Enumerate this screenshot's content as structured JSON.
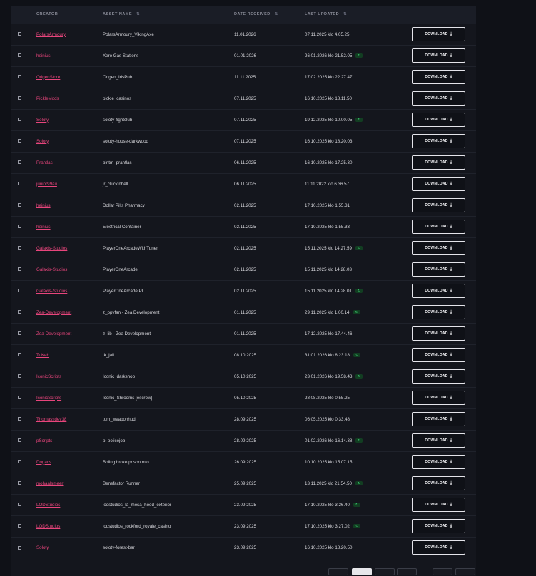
{
  "table": {
    "headers": {
      "creator": "CREATOR",
      "asset_name": "ASSET NAME",
      "date_received": "DATE RECEIVED",
      "last_updated": "LAST UPDATED",
      "sort_glyph": "⇅"
    },
    "download_label": "DOWNLOAD",
    "download_icon": "download-icon",
    "update_badge_icon": "refresh-icon",
    "accent_color": "#e8457c",
    "badge_color": "#3fd474",
    "rows": [
      {
        "creator": "PolarsArmoury",
        "asset": "PolarsArmoury_VikingAxe",
        "received": "11.01.2026",
        "updated": "07.11.2025 klo 4.05.25",
        "badge": false
      },
      {
        "creator": "heinius",
        "asset": "Xero Gas Stations",
        "received": "01.01.2026",
        "updated": "26.01.2026 klo 21.52.05",
        "badge": true
      },
      {
        "creator": "OrigenStore",
        "asset": "Origen_IrlsPub",
        "received": "11.11.2025",
        "updated": "17.02.2025 klo 22.27.47",
        "badge": false
      },
      {
        "creator": "PickleMods",
        "asset": "pickle_casinos",
        "received": "07.11.2025",
        "updated": "16.10.2025 klo 18.11.50",
        "badge": false
      },
      {
        "creator": "Soloty",
        "asset": "soloty-fightclub",
        "received": "07.11.2025",
        "updated": "19.12.2025 klo 10.00.05",
        "badge": true
      },
      {
        "creator": "Soloty",
        "asset": "soloty-house-darkwood",
        "received": "07.11.2025",
        "updated": "16.10.2025 klo 18.20.03",
        "badge": false
      },
      {
        "creator": "Prantlas",
        "asset": "bintm_prantlas",
        "received": "06.11.2025",
        "updated": "16.10.2025 klo 17.25.30",
        "badge": false
      },
      {
        "creator": "junior99au",
        "asset": "jr_cluckinbell",
        "received": "06.11.2025",
        "updated": "11.11.2022 klo 6.36.57",
        "badge": false
      },
      {
        "creator": "heinius",
        "asset": "Dollar Pills Pharmacy",
        "received": "02.11.2025",
        "updated": "17.10.2025 klo 1.55.31",
        "badge": false
      },
      {
        "creator": "heinius",
        "asset": "Electrical Container",
        "received": "02.11.2025",
        "updated": "17.10.2025 klo 1.55.33",
        "badge": false
      },
      {
        "creator": "Galaxis-Studios",
        "asset": "PlayerOneArcadeWithTuner",
        "received": "02.11.2025",
        "updated": "15.11.2025 klo 14.27.59",
        "badge": true
      },
      {
        "creator": "Galaxis-Studios",
        "asset": "PlayerOneArcade",
        "received": "02.11.2025",
        "updated": "15.11.2025 klo 14.28.03",
        "badge": false
      },
      {
        "creator": "Galaxis-Studios",
        "asset": "PlayerOneArcadeIPL",
        "received": "02.11.2025",
        "updated": "15.11.2025 klo 14.28.01",
        "badge": true
      },
      {
        "creator": "Zea-Development",
        "asset": "z_ppvfan - Zea Development",
        "received": "01.11.2025",
        "updated": "29.11.2025 klo 1.00.14",
        "badge": true
      },
      {
        "creator": "Zea-Development",
        "asset": "z_lib - Zea Development",
        "received": "01.11.2025",
        "updated": "17.12.2025 klo 17.44.46",
        "badge": false
      },
      {
        "creator": "TuKeh",
        "asset": "tk_jail",
        "received": "08.10.2025",
        "updated": "31.01.2026 klo 8.23.18",
        "badge": true
      },
      {
        "creator": "IconicScripts",
        "asset": "Iconic_darkshop",
        "received": "05.10.2025",
        "updated": "23.01.2026 klo 19.58.43",
        "badge": true
      },
      {
        "creator": "IconicScripts",
        "asset": "Iconic_Shrooms [escrow]",
        "received": "05.10.2025",
        "updated": "28.08.2025 klo 0.55.25",
        "badge": false
      },
      {
        "creator": "Thomassdev18",
        "asset": "tom_weaponhud",
        "received": "28.09.2025",
        "updated": "06.05.2025 klo 0.33.48",
        "badge": false
      },
      {
        "creator": "pScripts",
        "asset": "p_policejob",
        "received": "28.09.2025",
        "updated": "01.02.2026 klo 16.14.38",
        "badge": true
      },
      {
        "creator": "Dogacs",
        "asset": "Boling broke prison mlo",
        "received": "26.09.2025",
        "updated": "10.10.2025 klo 15.07.15",
        "badge": false
      },
      {
        "creator": "mohaalsmeer",
        "asset": "Benefactor Runner",
        "received": "25.09.2025",
        "updated": "13.11.2025 klo 21.54.50",
        "badge": true
      },
      {
        "creator": "LODStudios",
        "asset": "lodstudios_la_mesa_hood_exterior",
        "received": "23.09.2025",
        "updated": "17.10.2025 klo 3.26.40",
        "badge": true
      },
      {
        "creator": "LODStudios",
        "asset": "lodstudios_rockford_royale_casino",
        "received": "23.09.2025",
        "updated": "17.10.2025 klo 3.27.02",
        "badge": true
      },
      {
        "creator": "Soloty",
        "asset": "soloty-forest-bar",
        "received": "23.09.2025",
        "updated": "16.10.2025 klo 18.20.50",
        "badge": false
      }
    ]
  }
}
